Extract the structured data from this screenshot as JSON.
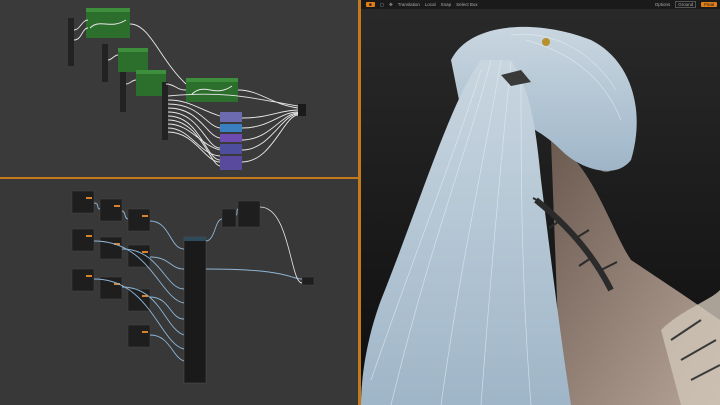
{
  "colors": {
    "accent": "#e07f18",
    "graph_bg": "#3a3a3a",
    "node_header_green": "#2c6e2c",
    "wire": "#e8e8e8",
    "wire_blue": "#8fb6d6"
  },
  "viewport_toolbar": {
    "items": [
      {
        "id": "translation",
        "label": "Translation",
        "icon": "move-icon"
      },
      {
        "id": "local",
        "label": "Local"
      },
      {
        "id": "snap",
        "label": "Snap"
      },
      {
        "id": "select",
        "label": "Select Box"
      }
    ],
    "right": {
      "options": "Options",
      "ground": "Ground",
      "render": "Final"
    }
  }
}
